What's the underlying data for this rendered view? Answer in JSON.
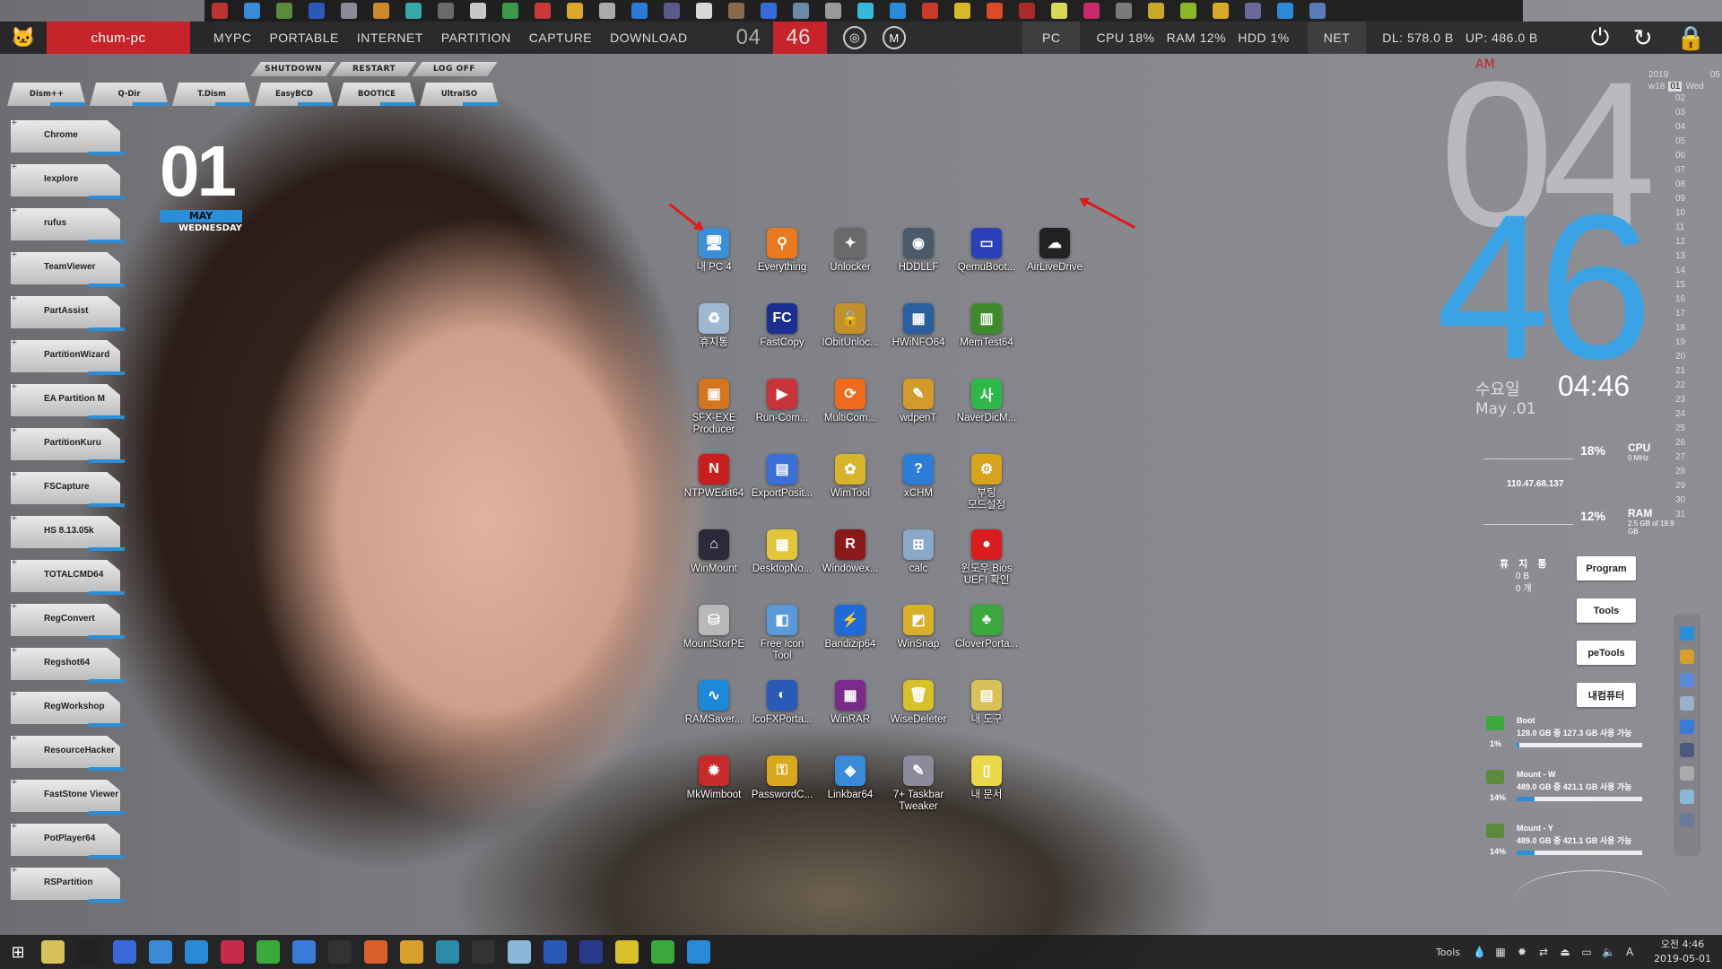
{
  "topbar": {
    "pc_name": "chum-pc",
    "menu": [
      "MYPC",
      "PORTABLE",
      "INTERNET",
      "PARTITION",
      "CAPTURE",
      "DOWNLOAD"
    ],
    "clock_hour": "04",
    "clock_min": "46",
    "pc_label": "PC",
    "cpu": "CPU  18%",
    "ram": "RAM  12%",
    "hdd": "HDD  1%",
    "net_label": "NET",
    "dl": "DL: 578.0 B",
    "up": "UP: 486.0 B"
  },
  "power_buttons": [
    "SHUTDOWN",
    "RESTART",
    "LOG OFF"
  ],
  "tool_tabs": [
    "Dism++",
    "Q-Dir",
    "T.Dism",
    "EasyBCD",
    "BOOTICE",
    "UltraISO"
  ],
  "launcher": [
    "Chrome",
    "Iexplore",
    "rufus",
    "TeamViewer",
    "PartAssist",
    "PartitionWizard",
    "EA Partition M",
    "PartitionKuru",
    "FSCapture",
    "HS 8.13.05k",
    "TOTALCMD64",
    "RegConvert",
    "Regshot64",
    "RegWorkshop",
    "ResourceHacker",
    "FastStone Viewer",
    "PotPlayer64",
    "RSPartition"
  ],
  "date_widget": {
    "day": "01",
    "month": "MAY",
    "weekday": "WEDNESDAY"
  },
  "desktop_icons": [
    {
      "name": "내 PC 4",
      "icon": "pc-icon",
      "color": "#3b8fd6",
      "glyph": "🖥"
    },
    {
      "name": "Everything",
      "icon": "search-icon",
      "color": "#e97a1f",
      "glyph": "⚲"
    },
    {
      "name": "Unlocker",
      "icon": "wand-icon",
      "color": "#6a6a6a",
      "glyph": "✦"
    },
    {
      "name": "HDDLLF",
      "icon": "hdd-icon",
      "color": "#4a5a6a",
      "glyph": "◉"
    },
    {
      "name": "QemuBoot...",
      "icon": "monitor-icon",
      "color": "#2b3fb8",
      "glyph": "▭"
    },
    {
      "name": "AirLiveDrive",
      "icon": "cloud-drive-icon",
      "color": "#222222",
      "glyph": "☁"
    },
    {
      "name": "휴지통",
      "icon": "recycle-bin-icon",
      "color": "#9db8d0",
      "glyph": "♻"
    },
    {
      "name": "FastCopy",
      "icon": "fastcopy-icon",
      "color": "#1a2f8f",
      "glyph": "FC"
    },
    {
      "name": "IObitUnloc...",
      "icon": "padlock-icon",
      "color": "#c4902a",
      "glyph": "🔓"
    },
    {
      "name": "HWiNFO64",
      "icon": "chip-icon",
      "color": "#2a5fa0",
      "glyph": "▦"
    },
    {
      "name": "MemTest64",
      "icon": "memory-icon",
      "color": "#3e8a2c",
      "glyph": "▥"
    },
    {
      "name": "",
      "icon": "blank",
      "color": "transparent",
      "glyph": ""
    },
    {
      "name": "SFX-EXE\nProducer",
      "icon": "box-icon",
      "color": "#d4751f",
      "glyph": "▣"
    },
    {
      "name": "Run-Com...",
      "icon": "run-icon",
      "color": "#c9333a",
      "glyph": "▶"
    },
    {
      "name": "MultiCom...",
      "icon": "multicom-icon",
      "color": "#ef6a1a",
      "glyph": "⟳"
    },
    {
      "name": "wdpenT",
      "icon": "pencil-icon",
      "color": "#d29a2a",
      "glyph": "✎"
    },
    {
      "name": "NaverDicM...",
      "icon": "dictionary-icon",
      "color": "#2fb84a",
      "glyph": "사"
    },
    {
      "name": "",
      "icon": "blank",
      "color": "transparent",
      "glyph": ""
    },
    {
      "name": "NTPWEdit64",
      "icon": "key-pin-icon",
      "color": "#c71e1e",
      "glyph": "N"
    },
    {
      "name": "ExportPosit...",
      "icon": "export-icon",
      "color": "#3a6ed8",
      "glyph": "▤"
    },
    {
      "name": "WimTool",
      "icon": "wimtool-icon",
      "color": "#d8b42a",
      "glyph": "✿"
    },
    {
      "name": "xCHM",
      "icon": "help-icon",
      "color": "#2a7ed8",
      "glyph": "?"
    },
    {
      "name": "부팅\n모드설정",
      "icon": "gear-icon",
      "color": "#d9a21e",
      "glyph": "⚙"
    },
    {
      "name": "",
      "icon": "blank",
      "color": "transparent",
      "glyph": ""
    },
    {
      "name": "WinMount",
      "icon": "winmount-icon",
      "color": "#2a2a3a",
      "glyph": "⌂"
    },
    {
      "name": "DesktopNo...",
      "icon": "notes-icon",
      "color": "#e2c53a",
      "glyph": "▦"
    },
    {
      "name": "Windowex...",
      "icon": "winex-icon",
      "color": "#8a1a1a",
      "glyph": "R"
    },
    {
      "name": "calc",
      "icon": "calculator-icon",
      "color": "#8aa8c8",
      "glyph": "⊞"
    },
    {
      "name": "윈도우 Bios\nUEFI 확인",
      "icon": "red-dot-icon",
      "color": "#d81e1e",
      "glyph": "●"
    },
    {
      "name": "",
      "icon": "blank",
      "color": "transparent",
      "glyph": ""
    },
    {
      "name": "MountStorPE",
      "icon": "drive-icon",
      "color": "#b8b8b8",
      "glyph": "⛁"
    },
    {
      "name": "Free Icon\nTool",
      "icon": "icon-tool-icon",
      "color": "#5a9ad8",
      "glyph": "◧"
    },
    {
      "name": "Bandizip64",
      "icon": "bandizip-icon",
      "color": "#1e6ad8",
      "glyph": "⚡"
    },
    {
      "name": "WinSnap",
      "icon": "snap-icon",
      "color": "#d8b02a",
      "glyph": "◩"
    },
    {
      "name": "CloverPorta...",
      "icon": "clover-icon",
      "color": "#3aa83a",
      "glyph": "♣"
    },
    {
      "name": "",
      "icon": "blank",
      "color": "transparent",
      "glyph": ""
    },
    {
      "name": "RAMSaver...",
      "icon": "pulse-icon",
      "color": "#1e88d8",
      "glyph": "∿"
    },
    {
      "name": "IcoFXPorta...",
      "icon": "icofx-icon",
      "color": "#2a5ab8",
      "glyph": "◐"
    },
    {
      "name": "WinRAR",
      "icon": "winrar-icon",
      "color": "#7a2a8a",
      "glyph": "▦"
    },
    {
      "name": "WiseDeleter",
      "icon": "trash-icon",
      "color": "#d8c02a",
      "glyph": "🗑"
    },
    {
      "name": "내 도구",
      "icon": "folder-tools-icon",
      "color": "#d8c05a",
      "glyph": "▤"
    },
    {
      "name": "",
      "icon": "blank",
      "color": "transparent",
      "glyph": ""
    },
    {
      "name": "MkWimboot",
      "icon": "mkwimboot-icon",
      "color": "#c72a2a",
      "glyph": "✹"
    },
    {
      "name": "PasswordC...",
      "icon": "key-icon",
      "color": "#d8a81e",
      "glyph": "⚿"
    },
    {
      "name": "Linkbar64",
      "icon": "cube-icon",
      "color": "#3a8ad8",
      "glyph": "◈"
    },
    {
      "name": "7+ Taskbar\nTweaker",
      "icon": "taskbar-tweaker-icon",
      "color": "#8a8a9a",
      "glyph": "✎"
    },
    {
      "name": "내 문서",
      "icon": "documents-icon",
      "color": "#e8d84a",
      "glyph": "▯"
    }
  ],
  "big_clock": {
    "ampm": "AM",
    "hour": "04",
    "minute": "46"
  },
  "calendar": {
    "year": "2019",
    "month": "05",
    "week": "w18",
    "today": "01",
    "weekday": "Wed",
    "days": [
      "02",
      "03",
      "04",
      "05",
      "06",
      "07",
      "08",
      "09",
      "10",
      "11",
      "12",
      "13",
      "14",
      "15",
      "16",
      "17",
      "18",
      "19",
      "20",
      "21",
      "22",
      "23",
      "24",
      "25",
      "26",
      "27",
      "28",
      "29",
      "30",
      "31"
    ]
  },
  "datetime_widget": {
    "weekday_ko": "수요일",
    "date": "May .01",
    "time": "04:46"
  },
  "sysmon": {
    "cpu_pct": "18%",
    "cpu_label": "CPU",
    "cpu_sub": "0 MHz",
    "ip": "110.47.68.137",
    "ram_pct": "12%",
    "ram_label": "RAM",
    "ram_sub": "2.5 GB of 19.9 GB"
  },
  "recycle": {
    "title": "휴 지 통",
    "size": "0 B",
    "count": "0 개"
  },
  "side_buttons": [
    "Program",
    "Tools",
    "peTools",
    "내컴퓨터"
  ],
  "drives": [
    {
      "name": "Boot",
      "space": "128.0 GB 중 127.3 GB 사용 가능",
      "pct": "1%",
      "fill": 0.01
    },
    {
      "name": "Mount - W",
      "space": "489.0 GB 중 421.1 GB 사용 가능",
      "pct": "14%",
      "fill": 0.14
    },
    {
      "name": "Mount - Y",
      "space": "489.0 GB 중 421.1 GB 사용 가능",
      "pct": "14%",
      "fill": 0.14
    }
  ],
  "taskbar": {
    "tools": "Tools",
    "time": "오전 4:46",
    "date": "2019-05-01"
  },
  "colors": {
    "accent_red": "#c6232a",
    "accent_blue": "#2a8fd8",
    "clock_blue": "#3aa3e6"
  }
}
